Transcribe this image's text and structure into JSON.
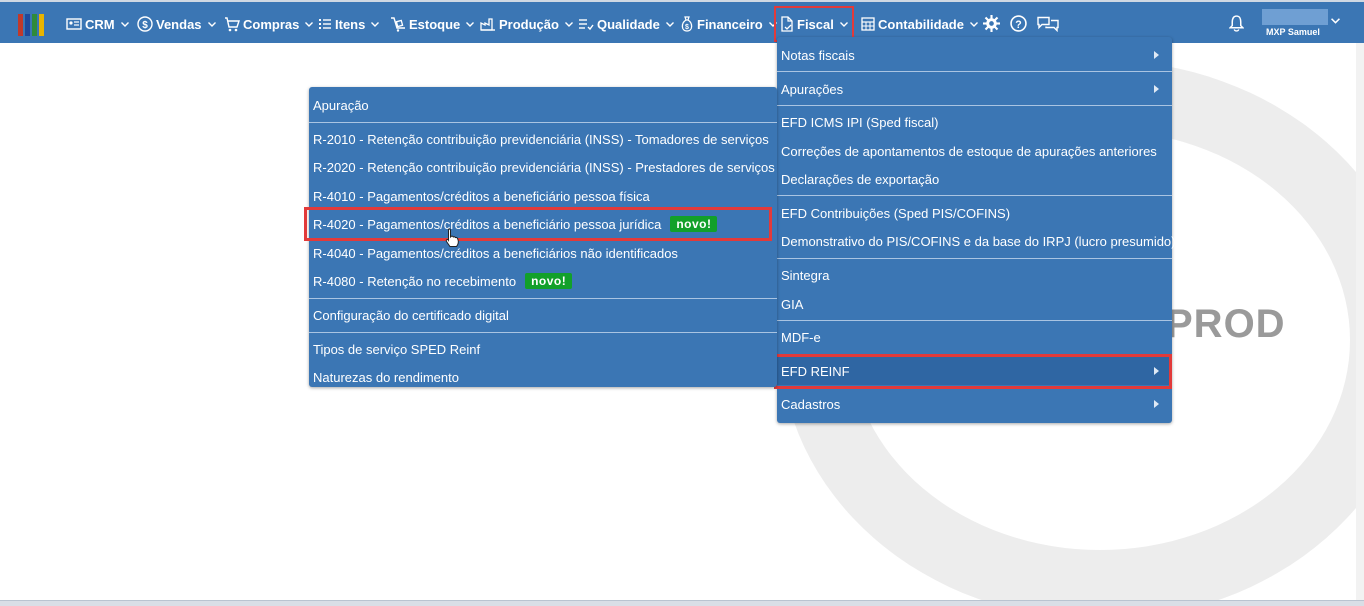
{
  "topbar": {
    "logo_colors": [
      "#c0392b",
      "#1e4a9c",
      "#2e8b3a",
      "#e8b400"
    ],
    "menus": [
      {
        "label": "CRM",
        "icon": "crm-icon"
      },
      {
        "label": "Vendas",
        "icon": "dollar-icon"
      },
      {
        "label": "Compras",
        "icon": "cart-icon"
      },
      {
        "label": "Itens",
        "icon": "items-icon"
      },
      {
        "label": "Estoque",
        "icon": "stock-icon"
      },
      {
        "label": "Produção",
        "icon": "factory-icon"
      },
      {
        "label": "Qualidade",
        "icon": "checklist-icon"
      },
      {
        "label": "Financeiro",
        "icon": "money-bag-icon"
      },
      {
        "label": "Fiscal",
        "icon": "fiscal-doc-icon"
      },
      {
        "label": "Contabilidade",
        "icon": "calculator-icon"
      }
    ],
    "active_menu": "Fiscal",
    "user_name": "MXP Samuel"
  },
  "background": {
    "watermark_text": "PROD"
  },
  "fiscal_menu": {
    "items": [
      {
        "label": "Notas fiscais",
        "submenu": true
      },
      {
        "label": "Apurações",
        "submenu": true
      },
      {
        "label": "EFD ICMS IPI (Sped fiscal)",
        "submenu": false
      },
      {
        "label": "Correções de apontamentos de estoque de apurações anteriores",
        "submenu": false
      },
      {
        "label": "Declarações de exportação",
        "submenu": false
      },
      {
        "label": "EFD Contribuições (Sped PIS/COFINS)",
        "submenu": false
      },
      {
        "label": "Demonstrativo do PIS/COFINS e da base do IRPJ (lucro presumido)",
        "submenu": false
      },
      {
        "label": "Sintegra",
        "submenu": false
      },
      {
        "label": "GIA",
        "submenu": false
      },
      {
        "label": "MDF-e",
        "submenu": false
      },
      {
        "label": "EFD REINF",
        "submenu": true
      },
      {
        "label": "Cadastros",
        "submenu": true
      }
    ]
  },
  "reinf_submenu": {
    "items": [
      {
        "label": "Apuração"
      },
      {
        "label": "R-2010 - Retenção contribuição previdenciária (INSS) - Tomadores de serviços"
      },
      {
        "label": "R-2020 - Retenção contribuição previdenciária (INSS) - Prestadores de serviços"
      },
      {
        "label": "R-4010 - Pagamentos/créditos a beneficiário pessoa física"
      },
      {
        "label": "R-4020 - Pagamentos/créditos a beneficiário pessoa jurídica",
        "badge": "novo!"
      },
      {
        "label": "R-4040 - Pagamentos/créditos a beneficiários não identificados"
      },
      {
        "label": "R-4080 - Retenção no recebimento",
        "badge": "novo!"
      },
      {
        "label": "Configuração do certificado digital"
      },
      {
        "label": "Tipos de serviço SPED Reinf"
      },
      {
        "label": "Naturezas do rendimento"
      }
    ]
  },
  "colors": {
    "nav_bg": "#3b76b4",
    "highlight": "#e23a3a",
    "badge_bg": "#12a02a"
  }
}
